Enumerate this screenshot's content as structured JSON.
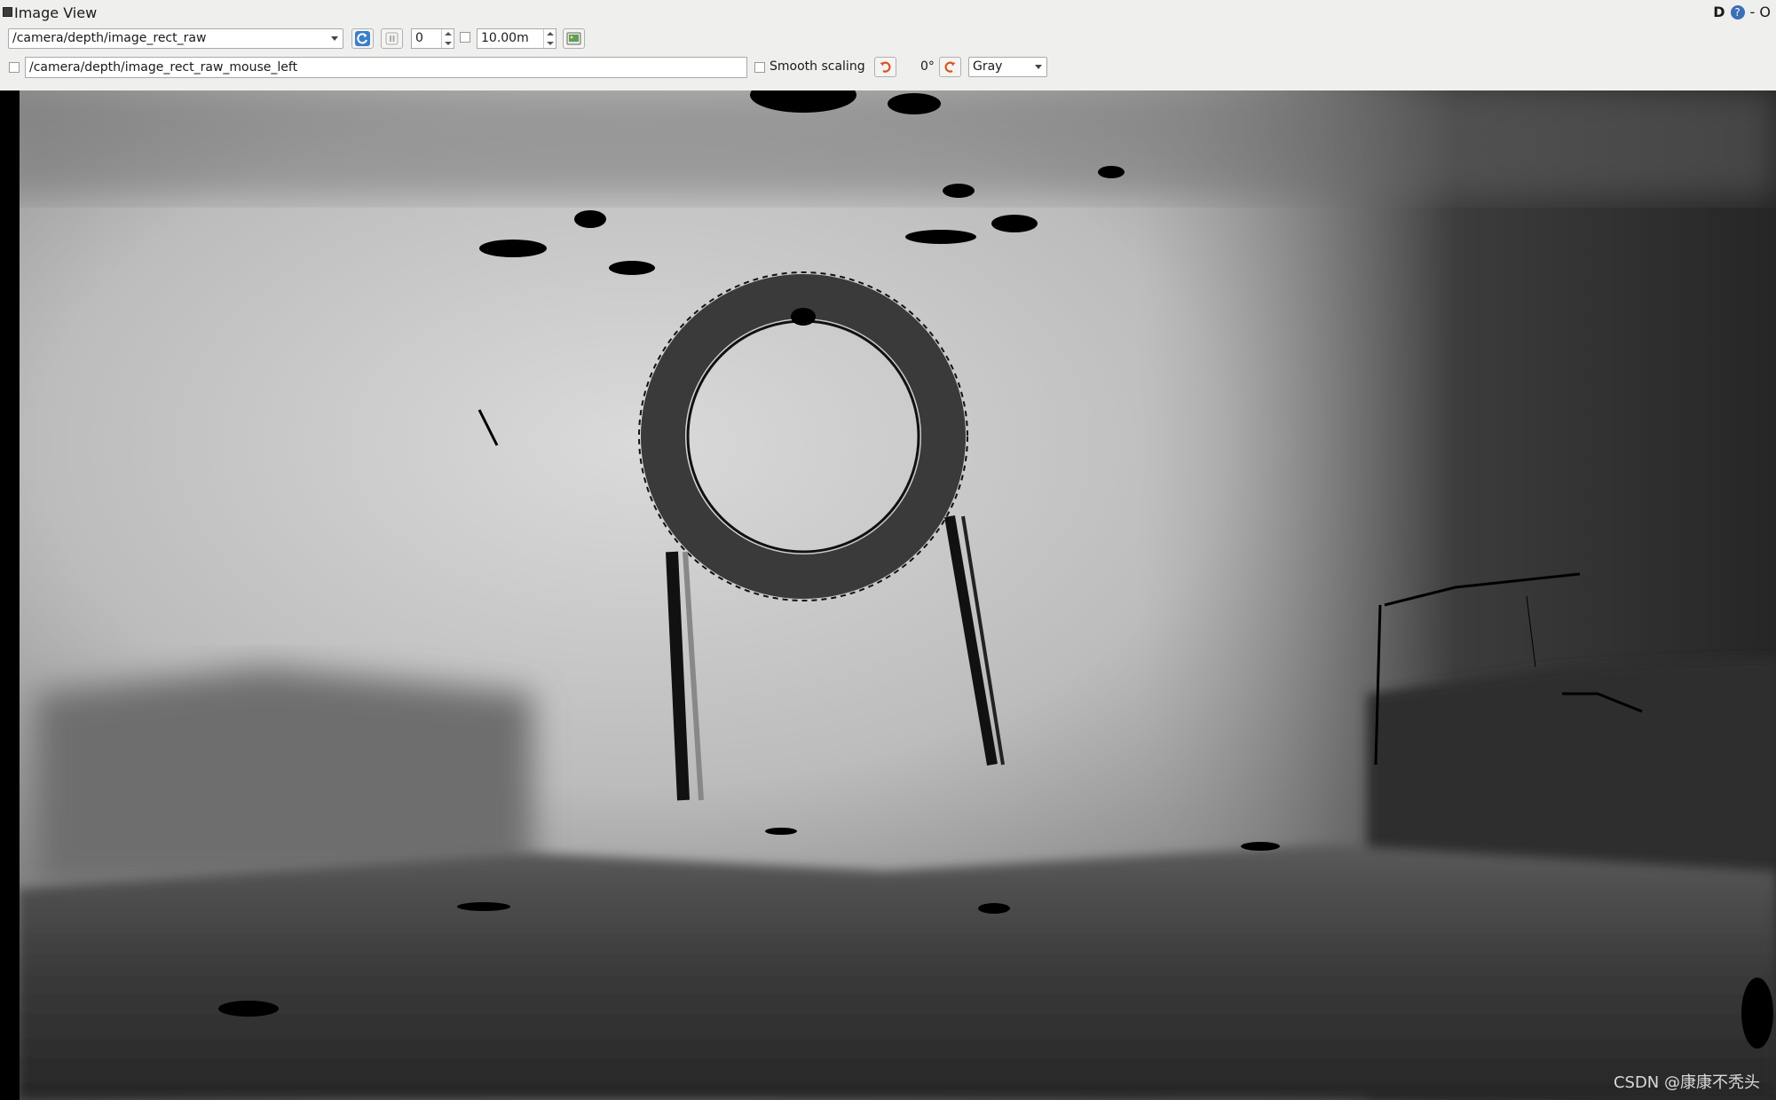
{
  "window": {
    "title": "Image View",
    "help_d": "D",
    "help_q": "?",
    "controls": "- O"
  },
  "toolbar": {
    "topic": "/camera/depth/image_rect_raw",
    "min_value": "0",
    "max_value": "10.00m",
    "mouse_topic": "/camera/depth/image_rect_raw_mouse_left",
    "smooth_scaling_label": "Smooth scaling",
    "rotation": "0°",
    "colormap": "Gray"
  },
  "image": {
    "watermark": "CSDN @康康不秃头"
  }
}
